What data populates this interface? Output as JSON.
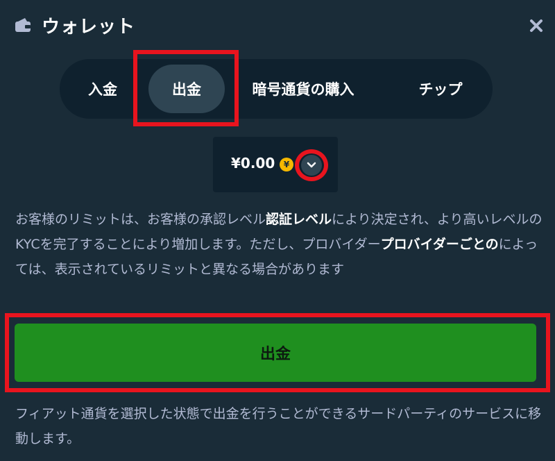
{
  "header": {
    "title": "ウォレット",
    "wallet_icon": "wallet-icon",
    "close_icon": "close-icon"
  },
  "tabs": [
    {
      "label": "入金",
      "active": false
    },
    {
      "label": "出金",
      "active": true
    },
    {
      "label": "暗号通貨の購入",
      "active": false
    },
    {
      "label": "チップ",
      "active": false
    }
  ],
  "balance": {
    "amount": "¥0.00",
    "currency_symbol": "¥",
    "dropdown_icon": "chevron-down-icon"
  },
  "info": {
    "part1": "お客様のリミットは、お客様の承認レベル",
    "bold1": "認証レベル",
    "part2": "により決定され、より高いレベルのKYCを完了することにより増加します。ただし、プロバイダー",
    "bold2": "プロバイダーごとの",
    "part3": "によっては、表示されているリミットと異なる場合があります"
  },
  "withdraw_button": {
    "label": "出金"
  },
  "footer": {
    "text": "フィアット通貨を選択した状態で出金を行うことができるサードパーティのサービスに移動します。"
  },
  "colors": {
    "background": "#1a2c38",
    "panel": "#0f212e",
    "active_tab": "#2f4553",
    "button_green": "#1f8f1f",
    "highlight_red": "#e8141e",
    "coin_gold": "#f5b800"
  }
}
